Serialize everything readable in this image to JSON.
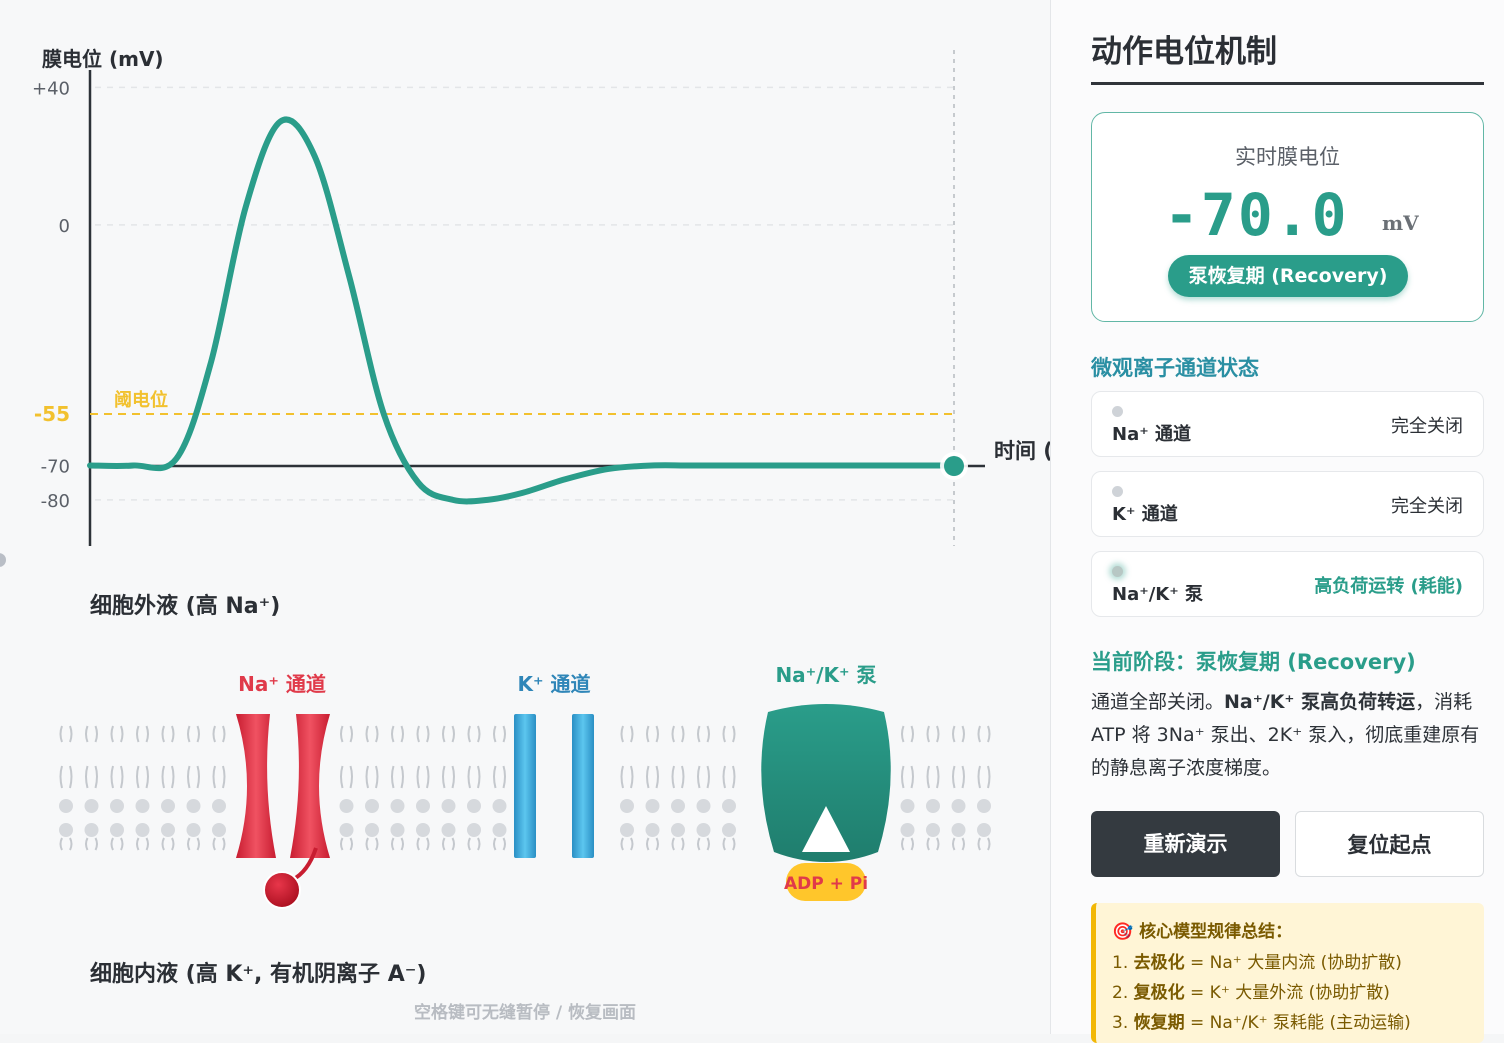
{
  "chart": {
    "ylabel": "膜电位 (mV)",
    "xlabel": "时间 (",
    "threshold_label": "阈电位",
    "tick_labels": [
      "+40",
      "0",
      "-55",
      "-70",
      "-80"
    ]
  },
  "chart_data": {
    "type": "line",
    "title": "",
    "xlabel": "时间 (",
    "ylabel": "膜电位 (mV)",
    "ylim": [
      -94,
      50
    ],
    "yticks": [
      40,
      0,
      -55,
      -70,
      -80
    ],
    "grid": true,
    "threshold": -55,
    "baseline": -70,
    "series": [
      {
        "x": [
          0,
          5,
          10,
          14,
          18,
          22,
          26,
          30,
          34,
          38,
          42,
          46,
          50,
          55,
          60,
          65,
          70,
          80,
          90,
          100
        ],
        "y": [
          -70,
          -70,
          -68,
          -40,
          5,
          30,
          20,
          -15,
          -55,
          -75,
          -80,
          -80,
          -78,
          -74,
          -71,
          -70,
          -70,
          -70,
          -70,
          -70
        ]
      }
    ]
  },
  "membrane": {
    "extracellular_label": "细胞外液 (高 Na⁺)",
    "intracellular_label": "细胞内液 (高 K⁺, 有机阴离子 A⁻)",
    "na_channel_label": "Na⁺ 通道",
    "k_channel_label": "K⁺ 通道",
    "pump_label": "Na⁺/K⁺ 泵",
    "adp_label": "ADP + Pi",
    "hint": "空格键可无缝暂停 / 恢复画面"
  },
  "panel": {
    "title": "动作电位机制",
    "live_label": "实时膜电位",
    "live_value": "-70.0",
    "live_unit": "mV",
    "phase_pill": "泵恢复期 (Recovery)",
    "micro_title": "微观离子通道状态",
    "channels": [
      {
        "name": "Na⁺ 通道",
        "state": "完全关闭"
      },
      {
        "name": "K⁺ 通道",
        "state": "完全关闭"
      },
      {
        "name": "Na⁺/K⁺ 泵",
        "state": "高负荷运转 (耗能)"
      }
    ],
    "stage_title": "当前阶段：泵恢复期 (Recovery)",
    "stage_desc_1": "通道全部关闭。",
    "stage_desc_bold": "Na⁺/K⁺ 泵高负荷转运",
    "stage_desc_2": "，消耗 ATP 将 3Na⁺ 泵出、2K⁺ 泵入，彻底重建原有的静息离子浓度梯度。",
    "btn_replay": "重新演示",
    "btn_reset": "复位起点",
    "summary_title": "核心模型规律总结：",
    "summary": [
      {
        "num": "1. ",
        "key": "去极化",
        "text": " = Na⁺ 大量内流 (协助扩散)"
      },
      {
        "num": "2. ",
        "key": "复极化",
        "text": " = K⁺ 大量外流 (协助扩散)"
      },
      {
        "num": "3. ",
        "key": "恢复期",
        "text": " = Na⁺/K⁺ 泵耗能 (主动运输)"
      }
    ]
  },
  "colors": {
    "accent": "#2a9d8a",
    "threshold": "#f2c12e",
    "na": "#e03a4a",
    "k": "#4ab3e0"
  }
}
